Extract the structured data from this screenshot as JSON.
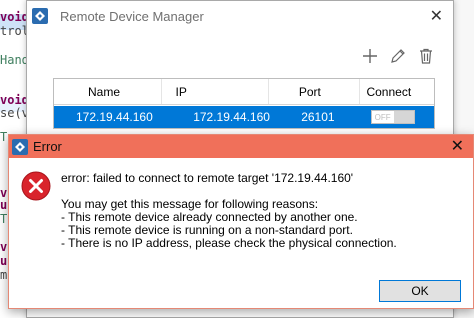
{
  "editor": {
    "lines": [
      "void",
      "troll",
      "Hand",
      "void",
      "se(vo",
      "T",
      "v",
      "u",
      "v",
      "T",
      "u",
      "m"
    ]
  },
  "device_manager": {
    "title": "Remote Device Manager",
    "close_glyph": "✕",
    "toolbar": {
      "add_icon": "plus-icon",
      "edit_icon": "pencil-icon",
      "delete_icon": "trash-icon"
    },
    "columns": [
      "Name",
      "IP",
      "Port",
      "Connect"
    ],
    "rows": [
      {
        "name": "172.19.44.160",
        "ip": "172.19.44.160",
        "port": "26101",
        "connect": "OFF"
      }
    ]
  },
  "error_dialog": {
    "title": "Error",
    "close_glyph": "✕",
    "headline": "error: failed to connect to remote target '172.19.44.160'",
    "intro": "You may get this message for following reasons:",
    "reasons": [
      " - This remote device already connected by another one.",
      " - This remote device is running on a non-standard port.",
      " - There is no IP address, please check the physical connection."
    ],
    "ok_label": "OK"
  },
  "colors": {
    "error_titlebar": "#f0705a",
    "selection": "#0078d7",
    "error_icon": "#d9242c"
  }
}
